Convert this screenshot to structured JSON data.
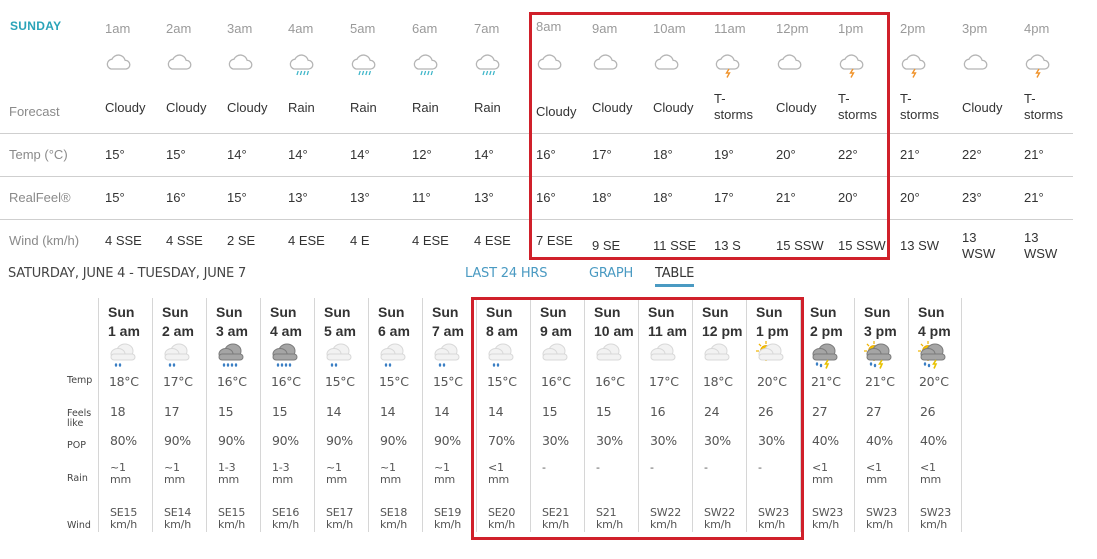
{
  "top": {
    "day_label": "SUNDAY",
    "row_labels": {
      "forecast": "Forecast",
      "temp": "Temp (°C)",
      "realfeel": "RealFeel®",
      "wind": "Wind (km/h)"
    },
    "hours": [
      {
        "time": "1am",
        "icon": "cloud-icon",
        "forecast": "Cloudy",
        "temp": "15°",
        "realfeel": "15°",
        "wind": "4 SSE"
      },
      {
        "time": "2am",
        "icon": "cloud-icon",
        "forecast": "Cloudy",
        "temp": "15°",
        "realfeel": "16°",
        "wind": "4 SSE"
      },
      {
        "time": "3am",
        "icon": "cloud-icon",
        "forecast": "Cloudy",
        "temp": "14°",
        "realfeel": "15°",
        "wind": "2 SE"
      },
      {
        "time": "4am",
        "icon": "rain-cloud-icon",
        "forecast": "Rain",
        "temp": "14°",
        "realfeel": "13°",
        "wind": "4 ESE"
      },
      {
        "time": "5am",
        "icon": "rain-cloud-icon",
        "forecast": "Rain",
        "temp": "14°",
        "realfeel": "13°",
        "wind": "4 E"
      },
      {
        "time": "6am",
        "icon": "rain-cloud-icon",
        "forecast": "Rain",
        "temp": "12°",
        "realfeel": "11°",
        "wind": "4 ESE"
      },
      {
        "time": "7am",
        "icon": "rain-cloud-icon",
        "forecast": "Rain",
        "temp": "14°",
        "realfeel": "13°",
        "wind": "4 ESE"
      },
      {
        "time": "8am",
        "icon": "cloud-icon",
        "forecast": "Cloudy",
        "temp": "16°",
        "realfeel": "16°",
        "wind": "7 ESE"
      },
      {
        "time": "9am",
        "icon": "cloud-icon",
        "forecast": "Cloudy",
        "temp": "17°",
        "realfeel": "18°",
        "wind": "9 SE"
      },
      {
        "time": "10am",
        "icon": "cloud-icon",
        "forecast": "Cloudy",
        "temp": "18°",
        "realfeel": "18°",
        "wind": "11 SSE"
      },
      {
        "time": "11am",
        "icon": "thunderstorm-icon",
        "forecast": "T-storms",
        "temp": "19°",
        "realfeel": "17°",
        "wind": "13 S"
      },
      {
        "time": "12pm",
        "icon": "cloud-icon",
        "forecast": "Cloudy",
        "temp": "20°",
        "realfeel": "21°",
        "wind": "15 SSW"
      },
      {
        "time": "1pm",
        "icon": "thunderstorm-icon",
        "forecast": "T-storms",
        "temp": "22°",
        "realfeel": "20°",
        "wind": "15 SSW"
      },
      {
        "time": "2pm",
        "icon": "thunderstorm-icon",
        "forecast": "T-storms",
        "temp": "21°",
        "realfeel": "20°",
        "wind": "13 SW"
      },
      {
        "time": "3pm",
        "icon": "cloud-icon",
        "forecast": "Cloudy",
        "temp": "22°",
        "realfeel": "23°",
        "wind": "13 WSW"
      },
      {
        "time": "4pm",
        "icon": "thunderstorm-icon",
        "forecast": "T-storms",
        "temp": "21°",
        "realfeel": "21°",
        "wind": "13 WSW"
      }
    ]
  },
  "middle": {
    "range_title": "SATURDAY, JUNE 4 - TUESDAY, JUNE 7",
    "tabs": [
      {
        "label": "LAST 24 HRS",
        "active": false
      },
      {
        "label": "GRAPH",
        "active": false
      },
      {
        "label": "TABLE",
        "active": true
      }
    ]
  },
  "bottom": {
    "row_labels": {
      "temp": "Temp",
      "feels_like_1": "Feels",
      "feels_like_2": "like",
      "pop": "POP",
      "rain": "Rain",
      "wind": "Wind"
    },
    "columns": [
      {
        "day": "Sun",
        "time": "1 am",
        "icon": "light-rain-icon",
        "temp": "18°C",
        "feels": "18",
        "pop": "80%",
        "rain1": "~1",
        "rain2": "mm",
        "wind1": "SE15",
        "wind2": "km/h"
      },
      {
        "day": "Sun",
        "time": "2 am",
        "icon": "light-rain-icon",
        "temp": "17°C",
        "feels": "17",
        "pop": "90%",
        "rain1": "~1",
        "rain2": "mm",
        "wind1": "SE14",
        "wind2": "km/h"
      },
      {
        "day": "Sun",
        "time": "3 am",
        "icon": "heavy-rain-icon",
        "temp": "16°C",
        "feels": "15",
        "pop": "90%",
        "rain1": "1-3",
        "rain2": "mm",
        "wind1": "SE15",
        "wind2": "km/h"
      },
      {
        "day": "Sun",
        "time": "4 am",
        "icon": "heavy-rain-icon",
        "temp": "16°C",
        "feels": "15",
        "pop": "90%",
        "rain1": "1-3",
        "rain2": "mm",
        "wind1": "SE16",
        "wind2": "km/h"
      },
      {
        "day": "Sun",
        "time": "5 am",
        "icon": "light-rain-icon",
        "temp": "15°C",
        "feels": "14",
        "pop": "90%",
        "rain1": "~1",
        "rain2": "mm",
        "wind1": "SE17",
        "wind2": "km/h"
      },
      {
        "day": "Sun",
        "time": "6 am",
        "icon": "light-rain-icon",
        "temp": "15°C",
        "feels": "14",
        "pop": "90%",
        "rain1": "~1",
        "rain2": "mm",
        "wind1": "SE18",
        "wind2": "km/h"
      },
      {
        "day": "Sun",
        "time": "7 am",
        "icon": "light-rain-icon",
        "temp": "15°C",
        "feels": "14",
        "pop": "90%",
        "rain1": "~1",
        "rain2": "mm",
        "wind1": "SE19",
        "wind2": "km/h"
      },
      {
        "day": "Sun",
        "time": "8 am",
        "icon": "light-rain-icon",
        "temp": "15°C",
        "feels": "14",
        "pop": "70%",
        "rain1": "<1",
        "rain2": "mm",
        "wind1": "SE20",
        "wind2": "km/h"
      },
      {
        "day": "Sun",
        "time": "9 am",
        "icon": "cloudy-icon",
        "temp": "16°C",
        "feels": "15",
        "pop": "30%",
        "rain1": "-",
        "rain2": "",
        "wind1": "SE21",
        "wind2": "km/h"
      },
      {
        "day": "Sun",
        "time": "10 am",
        "icon": "cloudy-icon",
        "temp": "16°C",
        "feels": "15",
        "pop": "30%",
        "rain1": "-",
        "rain2": "",
        "wind1": "S21",
        "wind2": "km/h"
      },
      {
        "day": "Sun",
        "time": "11 am",
        "icon": "cloudy-icon",
        "temp": "17°C",
        "feels": "16",
        "pop": "30%",
        "rain1": "-",
        "rain2": "",
        "wind1": "SW22",
        "wind2": "km/h"
      },
      {
        "day": "Sun",
        "time": "12 pm",
        "icon": "cloudy-icon",
        "temp": "18°C",
        "feels": "24",
        "pop": "30%",
        "rain1": "-",
        "rain2": "",
        "wind1": "SW22",
        "wind2": "km/h"
      },
      {
        "day": "Sun",
        "time": "1 pm",
        "icon": "partly-sunny-icon",
        "temp": "20°C",
        "feels": "26",
        "pop": "30%",
        "rain1": "-",
        "rain2": "",
        "wind1": "SW23",
        "wind2": "km/h"
      },
      {
        "day": "Sun",
        "time": "2 pm",
        "icon": "storm-icon",
        "temp": "21°C",
        "feels": "27",
        "pop": "40%",
        "rain1": "<1",
        "rain2": "mm",
        "wind1": "SW23",
        "wind2": "km/h"
      },
      {
        "day": "Sun",
        "time": "3 pm",
        "icon": "sun-storm-icon",
        "temp": "21°C",
        "feels": "27",
        "pop": "40%",
        "rain1": "<1",
        "rain2": "mm",
        "wind1": "SW23",
        "wind2": "km/h"
      },
      {
        "day": "Sun",
        "time": "4 pm",
        "icon": "sun-storm-icon",
        "temp": "20°C",
        "feels": "26",
        "pop": "40%",
        "rain1": "<1",
        "rain2": "mm",
        "wind1": "SW23",
        "wind2": "km/h"
      }
    ]
  },
  "colors": {
    "accent_teal": "#2aa3b8",
    "link_blue": "#4a9ac2",
    "highlight_red": "#d0202a",
    "rain_blue": "#3fb6c9",
    "lightning_orange": "#f0932b"
  }
}
